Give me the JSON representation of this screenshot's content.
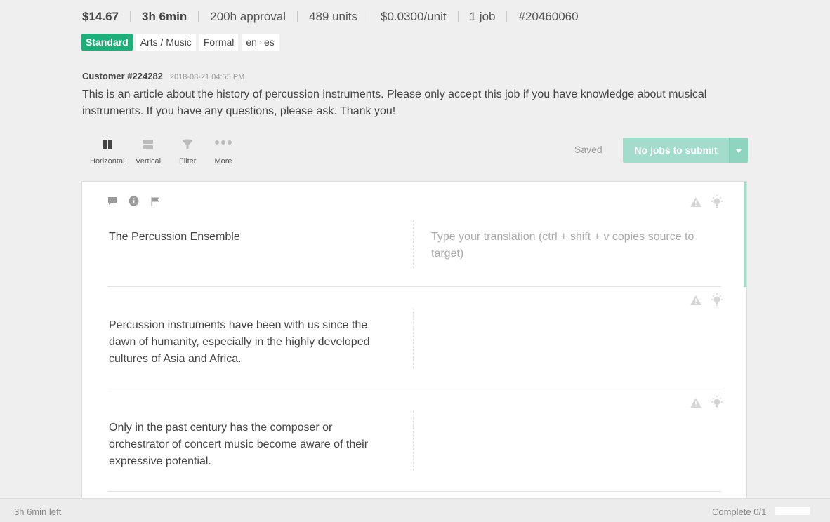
{
  "job": {
    "price": "$14.67",
    "duration": "3h 6min",
    "approval": "200h approval",
    "units": "489 units",
    "rate": "$0.0300/unit",
    "jobs": "1 job",
    "id": "#20460060"
  },
  "tags": {
    "tier": "Standard",
    "topic": "Arts / Music",
    "tone": "Formal",
    "source_lang": "en",
    "target_lang": "es"
  },
  "customer": {
    "name": "Customer #224282",
    "date": "2018-08-21 04:55 PM",
    "instructions": "This is an article about the history of percussion instruments. Please only accept this job if you have knowledge about musical instruments. If you have any questions, please ask. Thank you!"
  },
  "toolbar": {
    "horizontal": "Horizontal",
    "vertical": "Vertical",
    "filter": "Filter",
    "more": "More",
    "saved": "Saved",
    "submit": "No jobs to submit"
  },
  "segments": [
    {
      "source": "The Percussion Ensemble",
      "target_placeholder": "Type your translation (ctrl + shift + v copies source to target)"
    },
    {
      "source": "Percussion instruments have been with us since the dawn of humanity, especially in the highly developed cultures of Asia and Africa."
    },
    {
      "source": "Only in the past century has the composer or orchestrator of concert music become aware of their expressive potential."
    }
  ],
  "footer": {
    "time_left": "3h 6min left",
    "complete": "Complete 0/1",
    "progress_fraction": 0
  },
  "colors": {
    "accent": "#1fad7a",
    "submit_disabled": "#a3dccb",
    "background": "#efefef"
  },
  "icons": [
    "horizontal-layout-icon",
    "vertical-layout-icon",
    "filter-icon",
    "more-icon",
    "comment-icon",
    "info-icon",
    "flag-icon",
    "warning-icon",
    "lightbulb-icon",
    "chevron-down-icon"
  ]
}
